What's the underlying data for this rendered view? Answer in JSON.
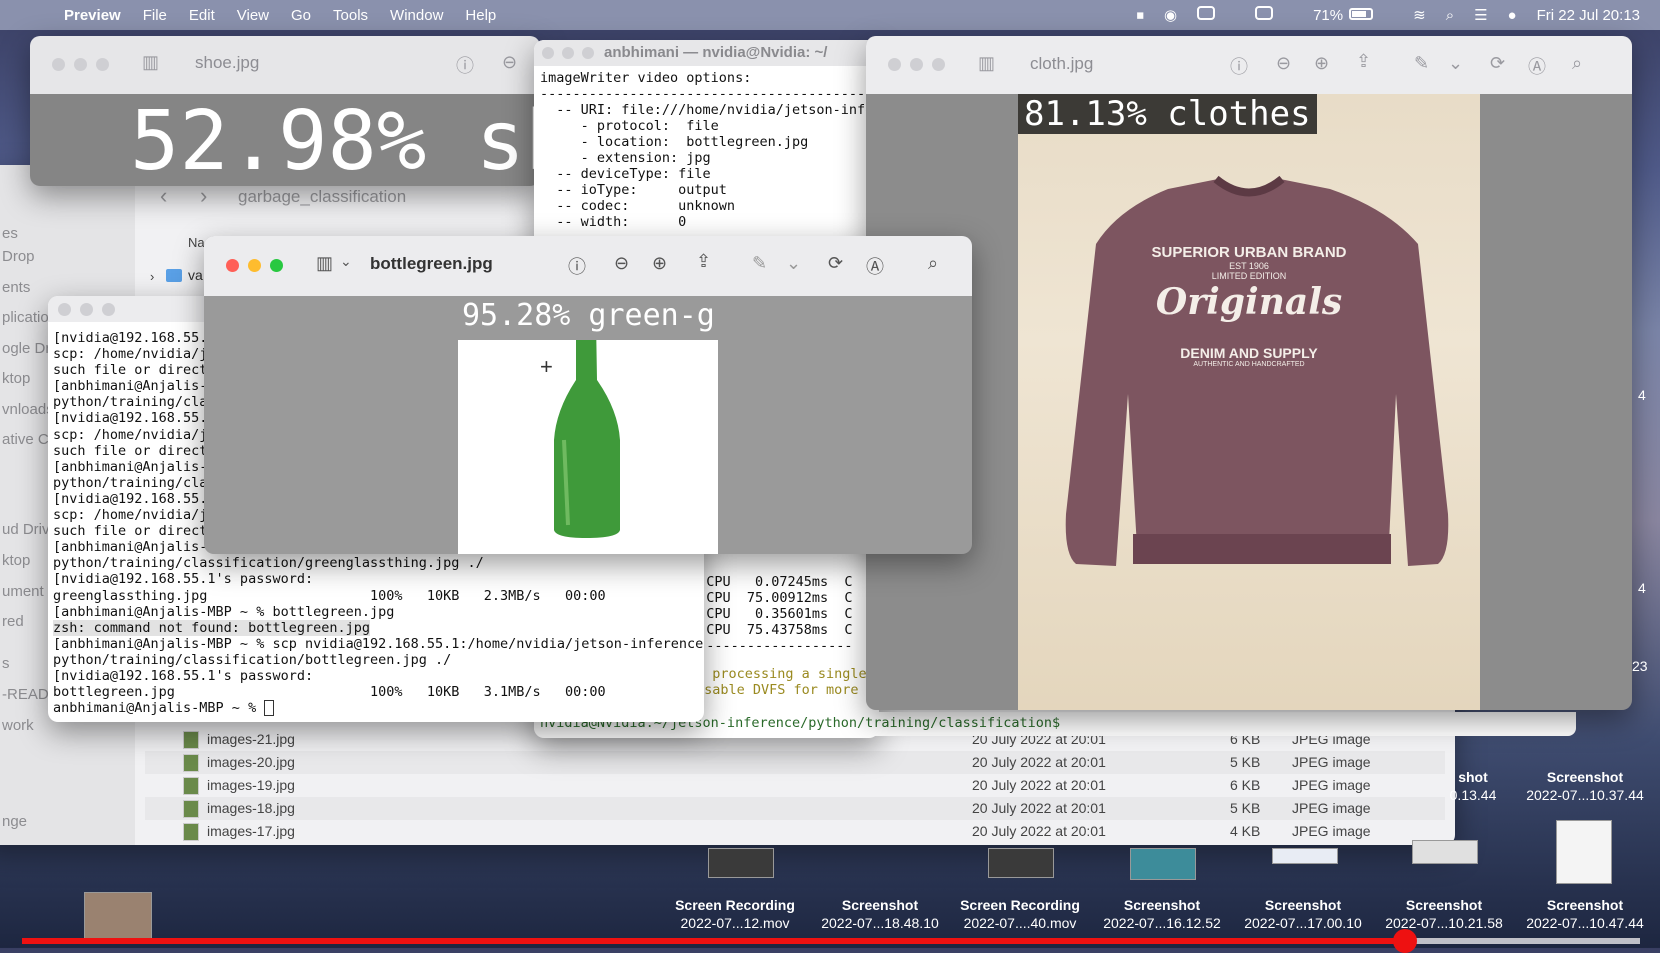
{
  "menubar": {
    "app": "Preview",
    "items": [
      "File",
      "Edit",
      "View",
      "Go",
      "Tools",
      "Window",
      "Help"
    ],
    "battery": "71%",
    "datetime": "Fri 22 Jul  20:13"
  },
  "shoe_window": {
    "title": "shoe.jpg",
    "overlay": "52.98% sh"
  },
  "finder": {
    "path": "garbage_classification",
    "column_name": "Na",
    "folder": "va",
    "sidebar": [
      "es",
      "Drop",
      "ents",
      "plication",
      "ogle Dri",
      "ktop",
      "vnloads",
      "ative C",
      "ud Driv",
      "ktop",
      "ument",
      "red",
      "s",
      "-READ",
      "work",
      "nge"
    ],
    "rows": [
      {
        "name": "images-21.jpg",
        "date": "20 July 2022 at 20:01",
        "size": "6 KB",
        "kind": "JPEG image"
      },
      {
        "name": "images-20.jpg",
        "date": "20 July 2022 at 20:01",
        "size": "5 KB",
        "kind": "JPEG image"
      },
      {
        "name": "images-19.jpg",
        "date": "20 July 2022 at 20:01",
        "size": "6 KB",
        "kind": "JPEG image"
      },
      {
        "name": "images-18.jpg",
        "date": "20 July 2022 at 20:01",
        "size": "5 KB",
        "kind": "JPEG image"
      },
      {
        "name": "images-17.jpg",
        "date": "20 July 2022 at 20:01",
        "size": "4 KB",
        "kind": "JPEG image"
      }
    ]
  },
  "term2": {
    "title": "anbhimani — nvidia@Nvidia: ~/",
    "lines": [
      "imageWriter video options:",
      "--------------------------------------------",
      "  -- URI: file:///home/nvidia/jetson-infe",
      "     - protocol:  file",
      "     - location:  bottlegreen.jpg",
      "     - extension: jpg",
      "  -- deviceType: file",
      "  -- ioType:     output",
      "  -- codec:      unknown",
      "  -- width:      0"
    ],
    "cpu_lines": [
      "  CPU   0.07245ms  C",
      "  CPU  75.00912ms  C",
      "  CPU   0.35601ms  C",
      "  CPU  75.43758ms  C",
      "--------------------"
    ],
    "warn_lines": [
      "h processing a single",
      "isable DVFS for more"
    ],
    "prompt": "nvidia@Nvidia:~/jetson-inference/python/training/classification$ "
  },
  "term1": {
    "lines": [
      "[nvidia@192.168.55.1",
      "scp: /home/nvidia/j",
      "such file or direct",
      "[anbhimani@Anjalis-M",
      "python/training/cla",
      "[nvidia@192.168.55.1",
      "scp: /home/nvidia/j",
      "such file or direct",
      "[anbhimani@Anjalis-M",
      "python/training/cla",
      "[nvidia@192.168.55.1",
      "scp: /home/nvidia/j",
      "such file or direct",
      "[anbhimani@Anjalis-M",
      "python/training/classification/greenglassthing.jpg ./",
      "[nvidia@192.168.55.1's password:",
      "greenglassthing.jpg                    100%   10KB   2.3MB/s   00:00",
      "[anbhimani@Anjalis-MBP ~ % bottlegreen.jpg",
      "zsh: command not found: bottlegreen.jpg",
      "[anbhimani@Anjalis-MBP ~ % scp nvidia@192.168.55.1:/home/nvidia/jetson-inference/",
      "python/training/classification/bottlegreen.jpg ./",
      "[nvidia@192.168.55.1's password:",
      "bottlegreen.jpg                        100%   10KB   3.1MB/s   00:00",
      "anbhimani@Anjalis-MBP ~ % "
    ]
  },
  "cloth_window": {
    "title": "cloth.jpg",
    "overlay": "81.13% clothes",
    "shirt_text": [
      "SUPERIOR URBAN BRAND",
      "EST 1906",
      "LIMITED EDITION",
      "Originals",
      "DENIM AND SUPPLY",
      "AUTHENTIC AND HANDCRAFTED"
    ]
  },
  "bottle_window": {
    "title": "bottlegreen.jpg",
    "overlay": "95.28% green-g"
  },
  "desktop_files": [
    {
      "t": "Screen Recording",
      "s": "2022-07...12.mov"
    },
    {
      "t": "Screenshot",
      "s": "2022-07...18.48.10"
    },
    {
      "t": "Screen Recording",
      "s": "2022-07....40.mov"
    },
    {
      "t": "Screenshot",
      "s": "2022-07...16.12.52"
    },
    {
      "t": "Screenshot",
      "s": "2022-07...17.00.10"
    },
    {
      "t": "Screenshot",
      "s": "2022-07...10.21.58"
    },
    {
      "t": "Screenshot",
      "s": "2022-07...10.47.44"
    }
  ],
  "desktop_files_top": [
    {
      "t": "shot",
      "s": "0.13.44"
    },
    {
      "t": "Screenshot",
      "s": "2022-07...10.37.44"
    }
  ],
  "edge_numbers": [
    "4",
    "4",
    "23"
  ],
  "video_progress": 0.855
}
